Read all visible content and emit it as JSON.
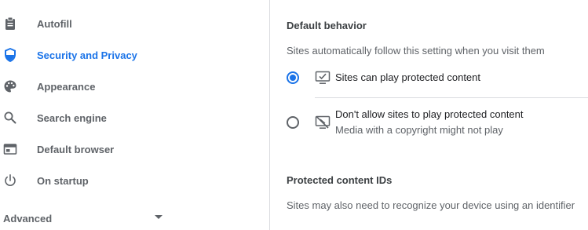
{
  "sidebar": {
    "items": [
      {
        "label": "Autofill",
        "icon": "clipboard-icon"
      },
      {
        "label": "Security and Privacy",
        "icon": "shield-icon",
        "active": true
      },
      {
        "label": "Appearance",
        "icon": "palette-icon"
      },
      {
        "label": "Search engine",
        "icon": "search-icon"
      },
      {
        "label": "Default browser",
        "icon": "browser-icon"
      },
      {
        "label": "On startup",
        "icon": "power-icon"
      }
    ],
    "advanced_label": "Advanced"
  },
  "main": {
    "default_behavior": {
      "heading": "Default behavior",
      "description": "Sites automatically follow this setting when you visit them",
      "options": [
        {
          "label": "Sites can play protected content",
          "sublabel": "",
          "selected": true,
          "icon": "monitor-check-icon"
        },
        {
          "label": "Don't allow sites to play protected content",
          "sublabel": "Media with a copyright might not play",
          "selected": false,
          "icon": "monitor-blocked-icon"
        }
      ]
    },
    "protected_ids": {
      "heading": "Protected content IDs",
      "description": "Sites may also need to recognize your device using an identifier"
    }
  },
  "colors": {
    "accent": "#1a73e8",
    "icon_gray": "#5f6368",
    "divider": "#dadce0"
  }
}
